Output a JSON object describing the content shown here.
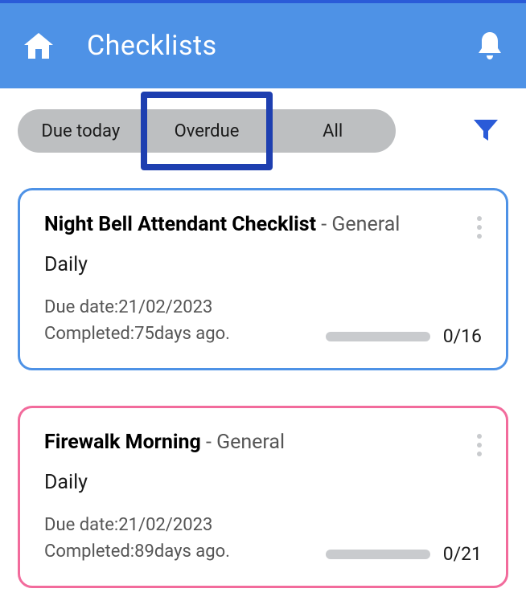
{
  "header": {
    "title": "Checklists"
  },
  "tabs": {
    "items": [
      {
        "label": "Due today"
      },
      {
        "label": "Overdue"
      },
      {
        "label": "All"
      }
    ],
    "selected_index": 1
  },
  "cards": [
    {
      "name": "Night Bell Attendant Checklist",
      "suffix": " - General",
      "frequency": "Daily",
      "due_label": "Due date:",
      "due_value": "21/02/2023",
      "completed_label": "Completed:",
      "completed_value": "75days ago.",
      "progress_text": "0/16",
      "border": "blue"
    },
    {
      "name": "Firewalk Morning",
      "suffix": " - General",
      "frequency": "Daily",
      "due_label": "Due date:",
      "due_value": "21/02/2023",
      "completed_label": "Completed:",
      "completed_value": "89days ago.",
      "progress_text": "0/21",
      "border": "pink"
    }
  ]
}
